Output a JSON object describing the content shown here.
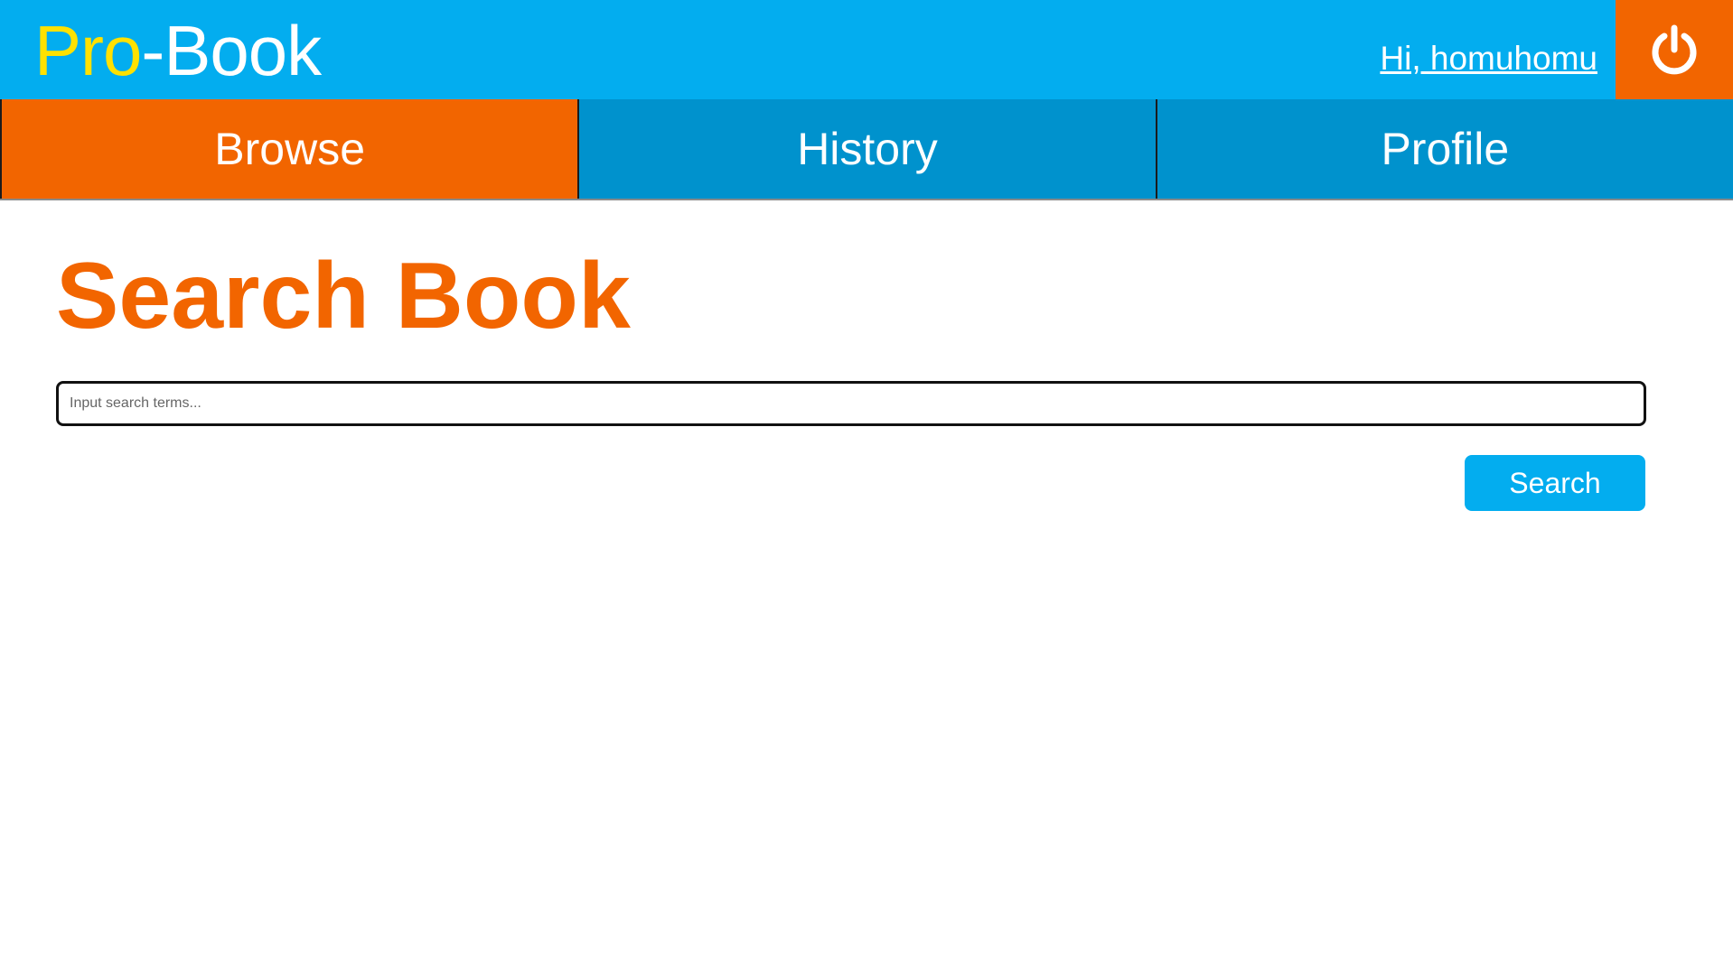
{
  "header": {
    "logo_accent": "Pro",
    "logo_rest": "-Book",
    "greeting": "Hi, homuhomu",
    "logout_icon": "power-icon"
  },
  "nav": {
    "tabs": [
      {
        "label": "Browse",
        "active": true
      },
      {
        "label": "History",
        "active": false
      },
      {
        "label": "Profile",
        "active": false
      }
    ]
  },
  "main": {
    "title": "Search Book",
    "search_placeholder": "Input search terms...",
    "search_value": "",
    "search_button": "Search"
  },
  "colors": {
    "header_bg": "#03adef",
    "nav_bg": "#0092cd",
    "accent_orange": "#f26500",
    "logo_yellow": "#ffe100"
  }
}
